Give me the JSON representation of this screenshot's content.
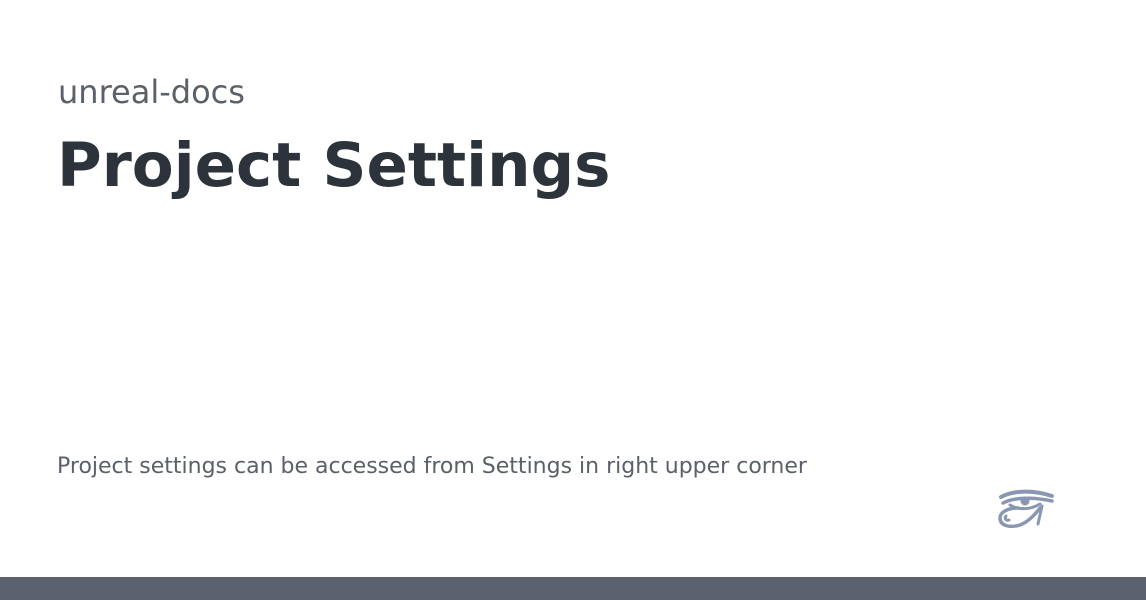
{
  "header": {
    "site_name": "unreal-docs",
    "title": "Project Settings"
  },
  "main": {
    "description": "Project settings can be accessed from Settings in right upper corner"
  },
  "logo": {
    "icon": "eye-of-horus-icon",
    "color": "#8a97b4"
  },
  "footer": {
    "bar_color": "#5c626d"
  },
  "colors": {
    "title": "#2d333b",
    "muted_text": "#5c6069",
    "background": "#ffffff"
  }
}
